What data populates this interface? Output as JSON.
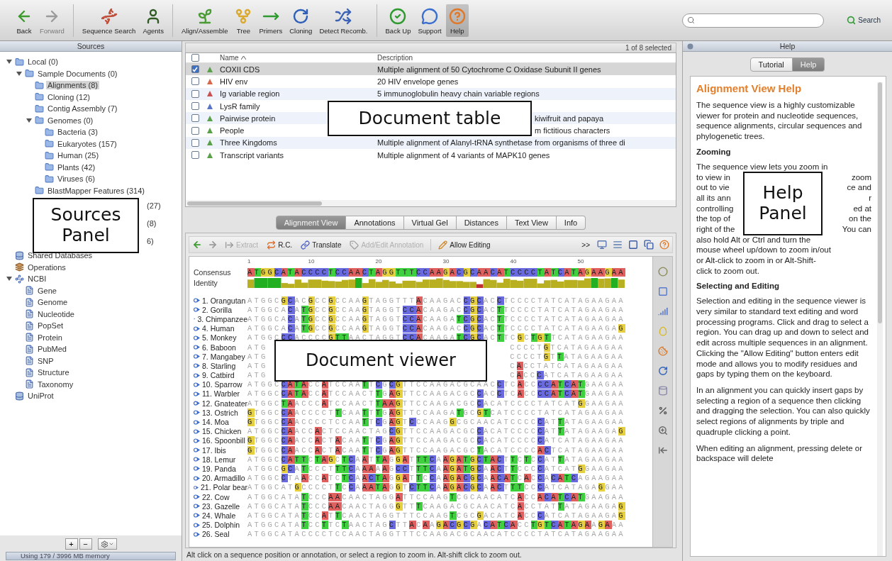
{
  "toolbar": {
    "groups": [
      [
        {
          "label": "Back",
          "disabled": false,
          "selected": false
        },
        {
          "label": "Forward",
          "disabled": true,
          "selected": false
        }
      ],
      [
        {
          "label": "Sequence Search",
          "disabled": false,
          "selected": false
        },
        {
          "label": "Agents",
          "disabled": false,
          "selected": false
        }
      ],
      [
        {
          "label": "Align/Assemble",
          "disabled": false,
          "selected": false
        },
        {
          "label": "Tree",
          "disabled": false,
          "selected": false
        },
        {
          "label": "Primers",
          "disabled": false,
          "selected": false
        },
        {
          "label": "Cloning",
          "disabled": false,
          "selected": false
        },
        {
          "label": "Detect Recomb.",
          "disabled": false,
          "selected": false
        }
      ],
      [
        {
          "label": "Back Up",
          "disabled": false,
          "selected": false
        },
        {
          "label": "Support",
          "disabled": false,
          "selected": false
        },
        {
          "label": "Help",
          "disabled": false,
          "selected": true
        }
      ]
    ],
    "search_button": "Search"
  },
  "sources": {
    "title": "Sources",
    "callout": "Sources Panel",
    "tree": [
      {
        "label": "Local (0)",
        "kind": "folder",
        "expanded": true,
        "selected": false,
        "children": [
          {
            "label": "Sample Documents (0)",
            "kind": "folder",
            "expanded": true,
            "selected": false,
            "children": [
              {
                "label": "Alignments (8)",
                "kind": "folder",
                "selected": true
              },
              {
                "label": "Cloning (12)",
                "kind": "folder",
                "selected": false
              },
              {
                "label": "Contig Assembly (7)",
                "kind": "folder",
                "selected": false
              },
              {
                "label": "Genomes (0)",
                "kind": "folder",
                "expanded": true,
                "selected": false,
                "children": [
                  {
                    "label": "Bacteria (3)",
                    "kind": "folder",
                    "selected": false
                  },
                  {
                    "label": "Eukaryotes (157)",
                    "kind": "folder",
                    "selected": false
                  },
                  {
                    "label": "Human (25)",
                    "kind": "folder",
                    "selected": false
                  },
                  {
                    "label": "Plants (42)",
                    "kind": "folder",
                    "selected": false
                  },
                  {
                    "label": "Viruses (6)",
                    "kind": "folder",
                    "selected": false
                  }
                ]
              },
              {
                "label": "BlastMapper Features (314)",
                "kind": "folder",
                "selected": false
              },
              {
                "label": "(27)",
                "kind": "fragment",
                "selected": false
              },
              {
                "label": "(8)",
                "kind": "fragment",
                "selected": false
              },
              {
                "label": "6)",
                "kind": "fragment",
                "selected": false
              }
            ]
          }
        ]
      },
      {
        "label": "Shared Databases",
        "kind": "database",
        "selected": false
      },
      {
        "label": "Operations",
        "kind": "operations",
        "selected": false
      },
      {
        "label": "NCBI",
        "kind": "ncbi",
        "expanded": true,
        "selected": false,
        "children": [
          {
            "label": "Gene",
            "kind": "ncbi-db",
            "selected": false
          },
          {
            "label": "Genome",
            "kind": "ncbi-db",
            "selected": false
          },
          {
            "label": "Nucleotide",
            "kind": "ncbi-db",
            "selected": false
          },
          {
            "label": "PopSet",
            "kind": "ncbi-db",
            "selected": false
          },
          {
            "label": "Protein",
            "kind": "ncbi-db",
            "selected": false
          },
          {
            "label": "PubMed",
            "kind": "ncbi-db",
            "selected": false
          },
          {
            "label": "SNP",
            "kind": "ncbi-db",
            "selected": false
          },
          {
            "label": "Structure",
            "kind": "ncbi-db",
            "selected": false
          },
          {
            "label": "Taxonomy",
            "kind": "ncbi-db",
            "selected": false
          }
        ]
      },
      {
        "label": "UniProt",
        "kind": "database",
        "selected": false
      }
    ],
    "buttons": [
      "+",
      "−"
    ],
    "memory": "Using 179 / 3996 MB memory"
  },
  "document_table": {
    "selection": "1 of 8 selected",
    "all_checked": false,
    "columns": [
      "Name",
      "Description"
    ],
    "callout": "Document table",
    "rows": [
      {
        "name": "COXII CDS",
        "description": "Multiple alignment of 50 Cytochrome C Oxidase Subunit II genes",
        "color": "#5aa048",
        "checked": true,
        "selected": true
      },
      {
        "name": "HIV env",
        "description": "20 HIV envelope genes",
        "color": "#d8684c",
        "checked": false,
        "selected": false
      },
      {
        "name": "Ig variable region",
        "description": "5 immunoglobulin heavy chain variable regions",
        "color": "#c85050",
        "checked": false,
        "selected": false
      },
      {
        "name": "LysR family",
        "color": "#5a74c8",
        "checked": false,
        "selected": false
      },
      {
        "name": "Pairwise protein",
        "description": "kiwifruit and papaya",
        "covered": true,
        "color": "#5aa048",
        "checked": false,
        "selected": false
      },
      {
        "name": "People",
        "description": "m fictitious characters",
        "covered": true,
        "color": "#5aa048",
        "checked": false,
        "selected": false
      },
      {
        "name": "Three Kingdoms",
        "description": "Multiple alignment of Alanyl-tRNA synthetase from organisms of three di",
        "color": "#5aa048",
        "checked": false,
        "selected": false
      },
      {
        "name": "Transcript variants",
        "description": "Multiple alignment of 4 variants of MAPK10 genes",
        "color": "#5aa048",
        "checked": false,
        "selected": false
      }
    ]
  },
  "viewer": {
    "tabs": [
      {
        "label": "Alignment View",
        "selected": true
      },
      {
        "label": "Annotations",
        "selected": false
      },
      {
        "label": "Virtual Gel",
        "selected": false
      },
      {
        "label": "Distances",
        "selected": false
      },
      {
        "label": "Text View",
        "selected": false
      },
      {
        "label": "Info",
        "selected": false
      }
    ],
    "tools": [
      {
        "label": "Extract",
        "disabled": true
      },
      {
        "label": "R.C.",
        "disabled": false
      },
      {
        "label": "Translate",
        "disabled": false
      },
      {
        "label": "Add/Edit Annotation",
        "disabled": true
      },
      {
        "label": "Allow Editing",
        "disabled": false
      }
    ],
    "overflow": ">>",
    "ruler": [
      "1",
      "10",
      "20",
      "30",
      "40",
      "50"
    ],
    "consensus_label": "Consensus",
    "identity_label": "Identity",
    "consensus": "ATGGCATACCCCTCCAACTAGGTTTCCAAGACGCAACATCCCCTATCATAGAAGAA",
    "callout": "Document viewer",
    "rows": [
      {
        "name": "1. Orangutan",
        "sequence": "ATGGCGCACGCCGCCAAGTAGGTTTACAAGACCGCACCTCCCCTATCATAGAAGAA"
      },
      {
        "name": "2. Gorilla",
        "sequence": "ATGGCACATGCCGCCAAGTAGGTCCACAAGACCGCACTTCCCCTATCATAGAAGAA"
      },
      {
        "name": "3. Chimpanzee",
        "sequence": "ATGGCACATGCCGCCAAGTAGGTCCACAAGATCGCACTTCCCCTATCATAGAAGAA"
      },
      {
        "name": "4. Human",
        "sequence": "ATGGCACATGCCGCCAAGTAGGTCCACAAGACCGCACTTCCCCTATCATAGAAGAG"
      },
      {
        "name": "5. Monkey",
        "sequence": "ATGGCCCACCCCGTTAACTAGGTCCACAAGATCGCACTTCGCTGTTCATAGAAGAA"
      },
      {
        "name": "6. Baboon",
        "sequence": "ATG",
        "sequence_end": "CCCCTGTCATAGAAGAA"
      },
      {
        "name": "7. Mangabey",
        "sequence": "ATG",
        "sequence_end": "CCCCTGTTATAGAAGAA"
      },
      {
        "name": "8. Starling",
        "sequence": "ATG",
        "sequence_end": "CACCTATCATAGAAGAA"
      },
      {
        "name": "9. Catbird",
        "sequence": "ATG",
        "sequence_end": "CACCCATCATAGAAGAA"
      },
      {
        "name": "10. Sparrow",
        "sequence": "ATGGCCATACCATCCAATTCGCGTTCCAAGACGCAACCTCACCCCATCATGAAGAA"
      },
      {
        "name": "11. Warbler",
        "sequence": "ATGGCCATACCATCCAACTTGAGTTCCAAGACGCCACCTCACCCCATCATGAAGAA"
      },
      {
        "name": "12. Gnateater",
        "sequence": "ATGGCTAACCCATCCAACTTAAGTTCCAAGACGCCACATCCCCTATCATGGAAGAA"
      },
      {
        "name": "13. Ostrich",
        "sequence": "GTGGCCAACCCCTTCAATTTGAGTTCCAAGATGCGTCATCCCCTATCATAGAAGAA"
      },
      {
        "name": "14. Moa",
        "sequence": "GTGGCCAACCCCTCCAATTCGAGTCCCAAGGCGCAACATCCCCCATTATAGAAGAA"
      },
      {
        "name": "15. Chicken",
        "sequence": "ATGGCCAACCACTCCAACTAGCGTTCCAAGACGCCACATCCCCCATTATAGAAGAG"
      },
      {
        "name": "16. Spoonbill",
        "sequence": "GTGGCCAACCACTACAATTCGAGTTCCAAGACGCCACATCCCCCATCATAGAAGAA"
      },
      {
        "name": "17. Ibis",
        "sequence": "GTGGCCAACCACTACAATTCGAGTTCCAAGACGCTACATCCCCACTCATAGAAGAA"
      },
      {
        "name": "18. Lemur",
        "sequence": "ATGGCCATTCTAGCTCAATTAGGATTTCAAGATGCTACTTCTCCATTATAGAAGAA"
      },
      {
        "name": "19. Panda",
        "sequence": "ATGGCGCATCCCTTTCAAAAAGCCTTTCAAGATGCAACTTCCCCATCATGGAAGAA"
      },
      {
        "name": "20. Armadillo",
        "sequence": "ATGGCCTAACCATCTCAACTAGGATTCCAAGACGCAACATCACCACATCAGAAGAA"
      },
      {
        "name": "21. Polar bear",
        "sequence": "ATGGCATGCCCCTTCCAAATAGGTCTTCAAGACGCAACTTTCCCATCATAGAGGAA"
      },
      {
        "name": "22. Cow",
        "sequence": "ATGGCATATCCCAACAACTAGGATTCCAAGTCGCAACATCACCACATCATGAAGAA"
      },
      {
        "name": "23. Gazelle",
        "sequence": "ATGGCATATCCCAACAACTAGGGTTTCAAGACGCAACATCACCTATTATAGAAGAG"
      },
      {
        "name": "24. Whale",
        "sequence": "ATGGCATATCCATTCAACTAGGTTTCCAAGTCGCGACATCACCCATCATAGAAGAG"
      },
      {
        "name": "25. Dolphin",
        "sequence": "ATGGCATATCCTTCTAACTAGCTTACAAGACGCGACATCACCTGTCATAGAAGAAA"
      },
      {
        "name": "26. Seal",
        "sequence": "ATGGCATACCCCTCCAACTAGGTTTCCAAGACGCAACATCCCCTATCATAGAAGAA"
      }
    ],
    "status": "Alt click on a sequence position or annotation, or select a region to zoom in. Alt-shift click to zoom out."
  },
  "help": {
    "title": "Help",
    "tabs": [
      {
        "label": "Tutorial",
        "selected": false
      },
      {
        "label": "Help",
        "selected": true
      }
    ],
    "heading": "Alignment View Help",
    "callout": "Help Panel",
    "blocks": [
      {
        "kind": "paragraph",
        "text": "The sequence view is a highly customizable viewer for protein and nucleotide sequences, sequence alignments, circular sequences and phylogenetic trees."
      },
      {
        "kind": "heading",
        "text": "Zooming"
      },
      {
        "kind": "lines",
        "lines": [
          {
            "text": "The sequence view lets you zoom in"
          },
          {
            "left": "to view in",
            "right": "zoom"
          },
          {
            "left": "out to vie",
            "right": "ce and"
          },
          {
            "left": "all its ann",
            "right": "r"
          },
          {
            "left": "controlling",
            "right": "ed at"
          },
          {
            "left": "the top of",
            "right": "on the"
          },
          {
            "left": "right of the",
            "right": "You can"
          },
          {
            "text": "also hold Alt or Ctrl and turn the"
          },
          {
            "text": "mouse wheel up/down to zoom in/out"
          },
          {
            "text": "or Alt-click to zoom in or Alt-Shift-"
          },
          {
            "text": "click to zoom out."
          }
        ]
      },
      {
        "kind": "heading",
        "text": "Selecting and Editing"
      },
      {
        "kind": "paragraph",
        "text": "Selection and editing in the sequence viewer is very similar to standard text editing and word processing programs. Click and drag to select a region. You can drag up and down to select and edit across multiple sequences in an alignment. Clicking the \"Allow Editing\" button enters edit mode and allows you to modify residues and gaps by typing them on the keyboard."
      },
      {
        "kind": "paragraph",
        "text": "In an alignment you can quickly insert gaps by selecting a region of a sequence then clicking and dragging the selection. You can also quickly select regions of alignments by triple and quadruple clicking a point."
      },
      {
        "kind": "paragraph",
        "text": "When editing an alignment, pressing delete or backspace will delete"
      }
    ]
  }
}
